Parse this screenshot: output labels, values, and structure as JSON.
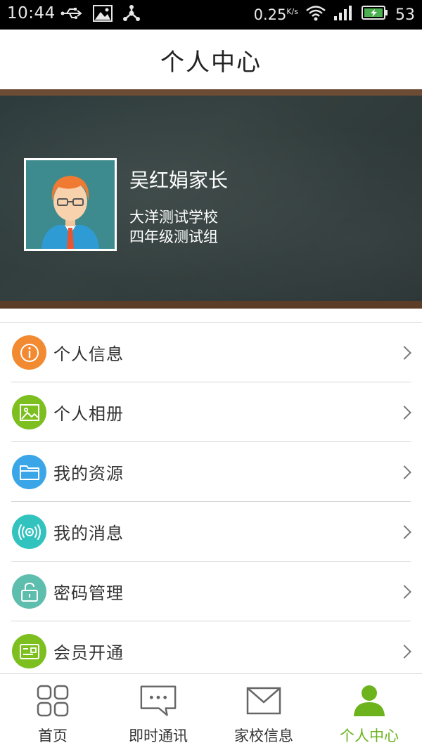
{
  "status_bar": {
    "time": "10:44",
    "speed": "0.25",
    "speed_unit": "K/s",
    "battery": "53"
  },
  "header": {
    "title": "个人中心"
  },
  "profile": {
    "name": "吴红娟家长",
    "school": "大洋测试学校",
    "group": "四年级测试组"
  },
  "menu": {
    "items": [
      {
        "label": "个人信息",
        "icon": "info-icon",
        "color": "#f28a32"
      },
      {
        "label": "个人相册",
        "icon": "image-icon",
        "color": "#7cbf1e"
      },
      {
        "label": "我的资源",
        "icon": "folder-icon",
        "color": "#3aa6e8"
      },
      {
        "label": "我的消息",
        "icon": "broadcast-icon",
        "color": "#33c3bf"
      },
      {
        "label": "密码管理",
        "icon": "lock-icon",
        "color": "#5ebeae"
      },
      {
        "label": "会员开通",
        "icon": "card-icon",
        "color": "#7cbf1e"
      }
    ]
  },
  "tabs": [
    {
      "label": "首页",
      "icon": "grid-icon"
    },
    {
      "label": "即时通讯",
      "icon": "chat-icon"
    },
    {
      "label": "家校信息",
      "icon": "mail-icon"
    },
    {
      "label": "个人中心",
      "icon": "person-icon",
      "active": true
    }
  ],
  "colors": {
    "accent": "#6cb31e",
    "statusbar": "#000000"
  }
}
